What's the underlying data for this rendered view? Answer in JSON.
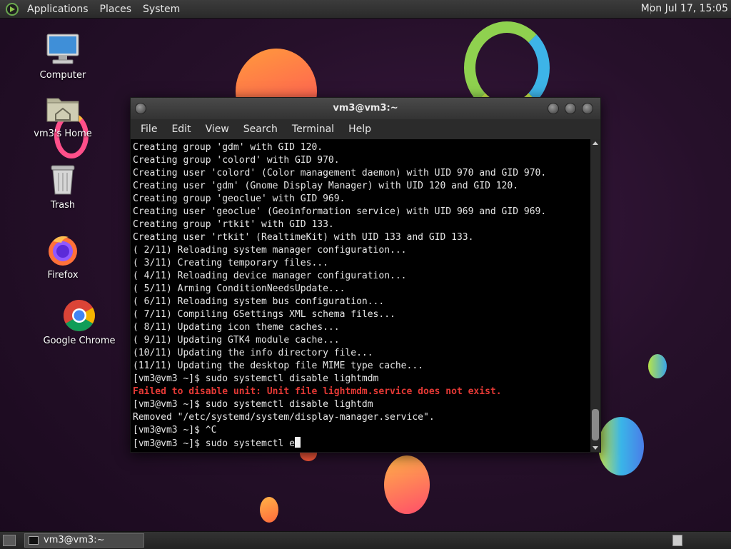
{
  "top_panel": {
    "menus": [
      "Applications",
      "Places",
      "System"
    ],
    "clock": "Mon Jul 17, 15:05"
  },
  "desktop_icons": [
    {
      "label": "Computer",
      "icon": "computer-icon"
    },
    {
      "label": "vm3's Home",
      "icon": "home-folder-icon"
    },
    {
      "label": "Trash",
      "icon": "trash-icon"
    },
    {
      "label": "Firefox",
      "icon": "firefox-icon"
    },
    {
      "label": "Google Chrome",
      "icon": "chrome-icon"
    }
  ],
  "window": {
    "title": "vm3@vm3:~",
    "menu": [
      "File",
      "Edit",
      "View",
      "Search",
      "Terminal",
      "Help"
    ]
  },
  "terminal": {
    "lines": [
      "Creating group 'gdm' with GID 120.",
      "Creating group 'colord' with GID 970.",
      "Creating user 'colord' (Color management daemon) with UID 970 and GID 970.",
      "Creating user 'gdm' (Gnome Display Manager) with UID 120 and GID 120.",
      "Creating group 'geoclue' with GID 969.",
      "Creating user 'geoclue' (Geoinformation service) with UID 969 and GID 969.",
      "Creating group 'rtkit' with GID 133.",
      "Creating user 'rtkit' (RealtimeKit) with UID 133 and GID 133.",
      "( 2/11) Reloading system manager configuration...",
      "( 3/11) Creating temporary files...",
      "( 4/11) Reloading device manager configuration...",
      "( 5/11) Arming ConditionNeedsUpdate...",
      "( 6/11) Reloading system bus configuration...",
      "( 7/11) Compiling GSettings XML schema files...",
      "( 8/11) Updating icon theme caches...",
      "( 9/11) Updating GTK4 module cache...",
      "(10/11) Updating the info directory file...",
      "(11/11) Updating the desktop file MIME type cache...",
      "[vm3@vm3 ~]$ sudo systemctl disable lightmdm",
      "Failed to disable unit: Unit file lightmdm.service does not exist.",
      "[vm3@vm3 ~]$ sudo systemctl disable lightdm",
      "Removed \"/etc/systemd/system/display-manager.service\".",
      "[vm3@vm3 ~]$ ^C"
    ],
    "error_line_index": 19,
    "prompt": "[vm3@vm3 ~]$ sudo systemctl e"
  },
  "taskbar": {
    "task_label": "vm3@vm3:~"
  },
  "colors": {
    "error": "#e53935",
    "terminal_bg": "#000000",
    "desktop_bg": "#26102a"
  }
}
